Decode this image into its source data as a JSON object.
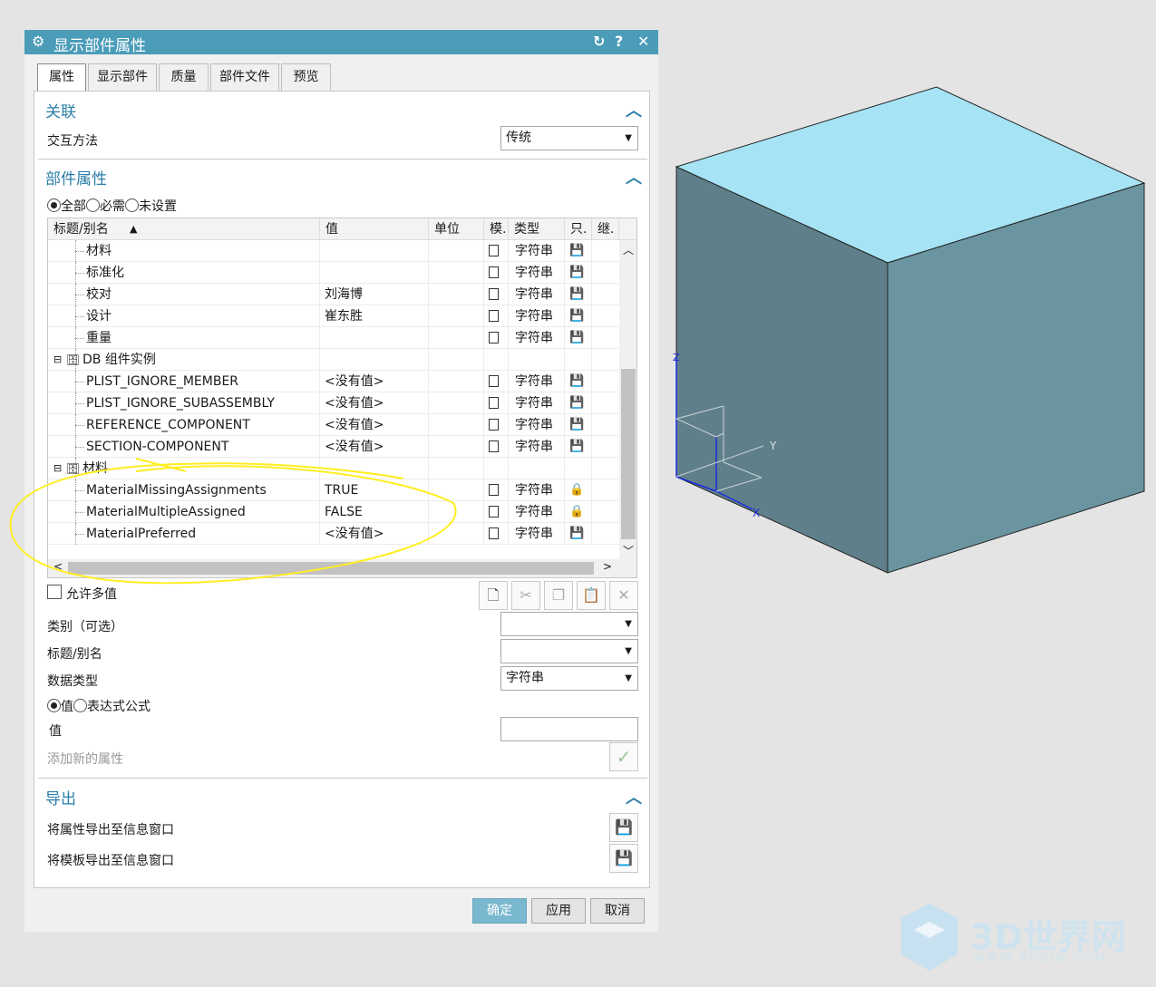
{
  "dialog": {
    "title": "显示部件属性",
    "title_icon": "gear-icon",
    "controls": {
      "reset": "↻",
      "help": "?",
      "close": "✕"
    }
  },
  "tabs": [
    "属性",
    "显示部件",
    "质量",
    "部件文件",
    "预览"
  ],
  "association": {
    "header": "关联",
    "interaction_label": "交互方法",
    "interaction_value": "传统"
  },
  "part_attributes": {
    "header": "部件属性",
    "filter": {
      "all": "全部",
      "required": "必需",
      "unset": "未设置"
    },
    "columns": [
      "标题/别名",
      "值",
      "单位",
      "模.",
      "类型",
      "只.",
      "继."
    ],
    "rows": [
      {
        "title": "材料",
        "value": "",
        "type": "字符串",
        "lock": "save"
      },
      {
        "title": "标准化",
        "value": "",
        "type": "字符串",
        "lock": "save"
      },
      {
        "title": "校对",
        "value": "刘海博",
        "type": "字符串",
        "lock": "save"
      },
      {
        "title": "设计",
        "value": "崔东胜",
        "type": "字符串",
        "lock": "save"
      },
      {
        "title": "重量",
        "value": "",
        "type": "字符串",
        "lock": "save"
      },
      {
        "group": "DB 组件实例"
      },
      {
        "title": "PLIST_IGNORE_MEMBER",
        "value": "<没有值>",
        "type": "字符串",
        "lock": "save"
      },
      {
        "title": "PLIST_IGNORE_SUBASSEMBLY",
        "value": "<没有值>",
        "type": "字符串",
        "lock": "save"
      },
      {
        "title": "REFERENCE_COMPONENT",
        "value": "<没有值>",
        "type": "字符串",
        "lock": "save"
      },
      {
        "title": "SECTION-COMPONENT",
        "value": "<没有值>",
        "type": "字符串",
        "lock": "save"
      },
      {
        "group": "材料"
      },
      {
        "title": "MaterialMissingAssignments",
        "value": "TRUE",
        "type": "字符串",
        "lock": "lock"
      },
      {
        "title": "MaterialMultipleAssigned",
        "value": "FALSE",
        "type": "字符串",
        "lock": "lock"
      },
      {
        "title": "MaterialPreferred",
        "value": "<没有值>",
        "type": "字符串",
        "lock": "save"
      }
    ],
    "allow_multi": "允许多值",
    "category_label": "类别（可选）",
    "category_value": "",
    "title_label": "标题/别名",
    "title_value": "",
    "datatype_label": "数据类型",
    "datatype_value": "字符串",
    "mode": {
      "value": "值",
      "expression": "表达式公式"
    },
    "value_label": "值",
    "value_input": "",
    "add_label": "添加新的属性"
  },
  "export": {
    "header": "导出",
    "attr_to_info": "将属性导出至信息窗口",
    "template_to_info": "将模板导出至信息窗口"
  },
  "buttons": {
    "ok": "确定",
    "apply": "应用",
    "cancel": "取消"
  },
  "viewport": {
    "axis_z": "Z",
    "axis_y": "Y",
    "axis_x": "X",
    "cube_top_color": "#a6e3f4",
    "cube_left_color": "#5f808a",
    "cube_right_color": "#6a95a0"
  },
  "watermark": {
    "brand": "3D世界网",
    "url": "WWW.3DSJW.COM"
  }
}
